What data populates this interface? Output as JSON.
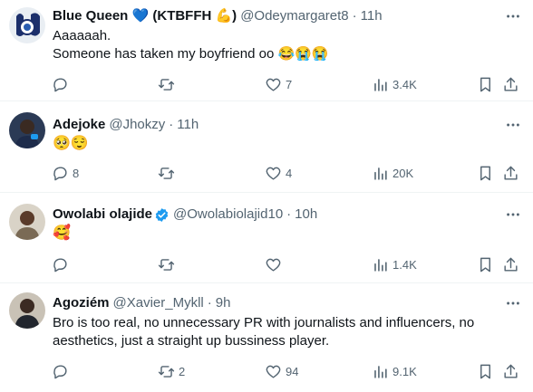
{
  "colors": {
    "text": "#0f1419",
    "muted": "#536471",
    "verified": "#1d9bf0",
    "divider": "#eff3f4"
  },
  "tweets": [
    {
      "name": "Blue Queen 💙 (KTBFFH 💪)",
      "handle": "@Odeymargaret8",
      "separator": "·",
      "time": "11h",
      "lines": [
        "Aaaaaah.",
        "Someone has taken my boyfriend oo 😂😭😭"
      ],
      "replies": "",
      "retweets": "",
      "likes": "7",
      "views": "3.4K",
      "avatar_icon": "chelsea-fan-avatar"
    },
    {
      "name": "Adejoke",
      "handle": "@Jhokzy",
      "separator": "·",
      "time": "11h",
      "lines": [
        "🥺😌"
      ],
      "replies": "8",
      "retweets": "",
      "likes": "4",
      "views": "20K",
      "avatar_icon": "person-avatar"
    },
    {
      "name": "Owolabi olajide",
      "handle": "@Owolabiolajid10",
      "separator": "·",
      "time": "10h",
      "verified": true,
      "lines": [
        "🥰"
      ],
      "replies": "",
      "retweets": "",
      "likes": "",
      "views": "1.4K",
      "avatar_icon": "person-avatar"
    },
    {
      "name": "Agoziém",
      "handle": "@Xavier_Mykll",
      "separator": "·",
      "time": "9h",
      "lines": [
        "Bro is too real, no unnecessary PR with journalists and influencers, no",
        "aesthetics, just a straight up bussiness player."
      ],
      "replies": "",
      "retweets": "2",
      "likes": "94",
      "views": "9.1K",
      "avatar_icon": "person-avatar"
    }
  ]
}
